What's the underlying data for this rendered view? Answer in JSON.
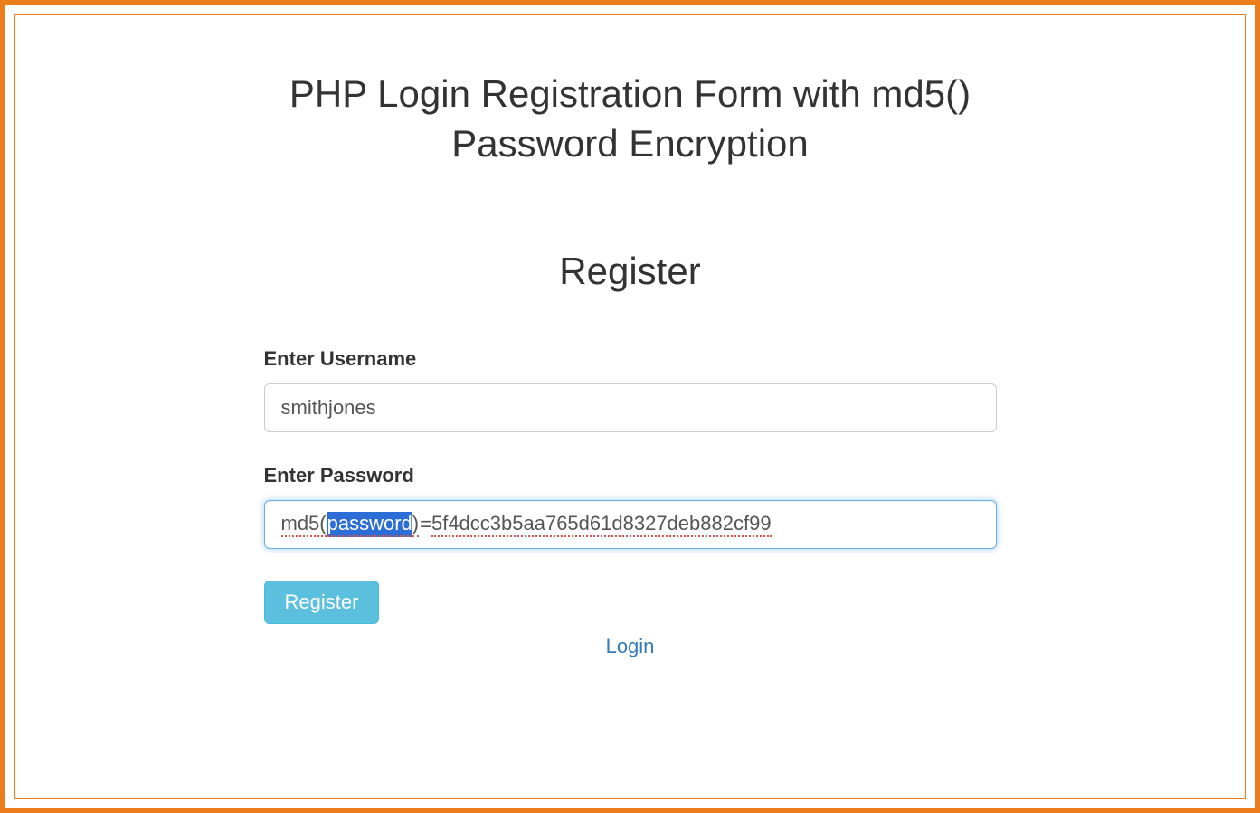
{
  "header": {
    "title": "PHP Login Registration Form with md5() Password Encryption"
  },
  "section": {
    "title": "Register"
  },
  "form": {
    "username": {
      "label": "Enter Username",
      "value": "smithjones"
    },
    "password": {
      "label": "Enter Password",
      "prefix": "md5(",
      "selected": "password",
      "suffix_paren": ")",
      "equals": " = ",
      "hash": "5f4dcc3b5aa765d61d8327deb882cf99"
    },
    "submit_label": "Register",
    "login_link_label": "Login"
  }
}
